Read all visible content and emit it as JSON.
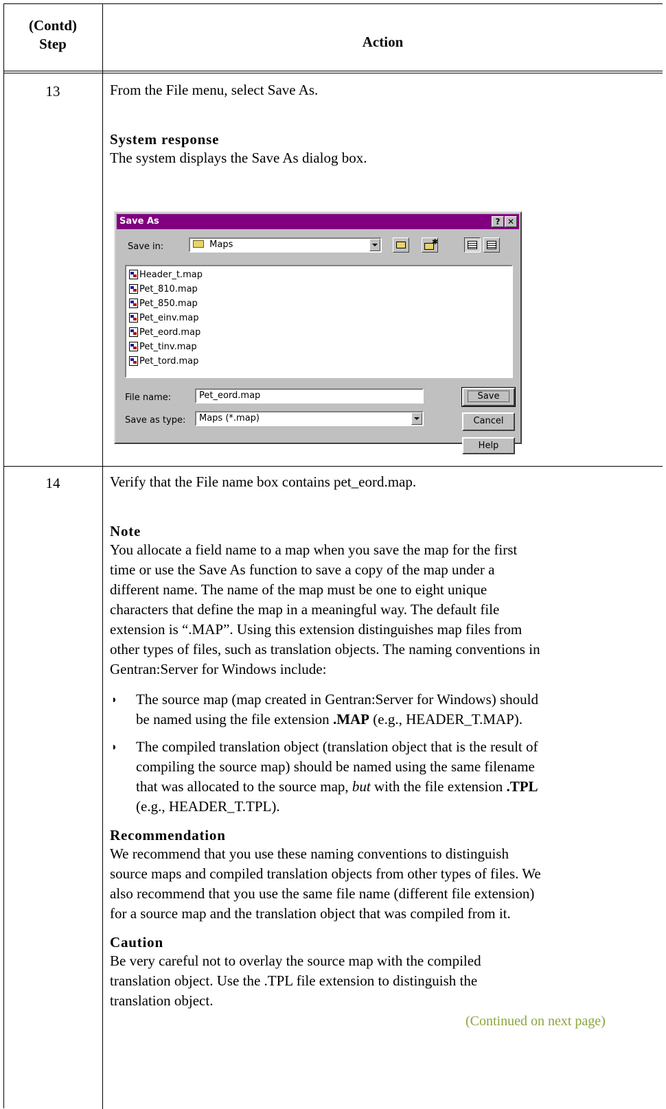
{
  "table": {
    "header_step": "(Contd)\nStep",
    "header_step_line1": "(Contd)",
    "header_step_line2": "Step",
    "header_action": "Action"
  },
  "step13": {
    "number": "13",
    "instruction": "From the File menu, select Save As.",
    "system_response_heading": "System response",
    "system_response_text": "The system displays the Save As dialog box."
  },
  "dialog": {
    "title": "Save As",
    "help_button": "?",
    "close_button": "✕",
    "save_in_label": "Save in:",
    "save_in_value": "Maps",
    "files": [
      "Header_t.map",
      "Pet_810.map",
      "Pet_850.map",
      "Pet_einv.map",
      "Pet_eord.map",
      "Pet_tinv.map",
      "Pet_tord.map"
    ],
    "file_name_label": "File name:",
    "file_name_value": "Pet_eord.map",
    "save_as_type_label": "Save as type:",
    "save_as_type_value": "Maps (*.map)",
    "save_button": "Save",
    "cancel_button": "Cancel",
    "help_label": "Help"
  },
  "step14": {
    "number": "14",
    "instruction": "Verify that the File name box contains pet_eord.map.",
    "note_heading": "Note",
    "note_lines": [
      "You allocate a field name to a map when you save the map for the first",
      "time or use the Save As function to save a copy of the map under a",
      "different name. The name of the map must be one to eight unique",
      "characters that define the map in a meaningful way. The default file",
      "extension is “.MAP”. Using this extension distinguishes map files from",
      "other types of files, such as translation objects. The naming conventions in",
      "Gentran:Server for Windows include:"
    ],
    "bullet_mark": "◗",
    "bullet1_line1": "The source map (map created in Gentran:Server for Windows) should",
    "bullet1_line2_pre": "be named using the file extension ",
    "bullet1_line2_bold": ".MAP",
    "bullet1_line2_post": " (e.g., HEADER_T.MAP).",
    "bullet2_line1": "The compiled translation object (translation object that is the result of",
    "bullet2_line2": "compiling the source map) should be named using the same filename",
    "bullet2_line3_pre": "that was allocated to the source map, ",
    "bullet2_line3_italic": "but",
    "bullet2_line3_mid": " with the file extension ",
    "bullet2_line3_bold": ".TPL",
    "bullet2_line4": "(e.g., HEADER_T.TPL).",
    "recommendation_heading": "Recommendation",
    "recommendation_lines": [
      "We recommend that you use these naming conventions to distinguish",
      "source maps and compiled translation objects from other types of files. We",
      "also recommend that you use the same file name (different file extension)",
      "for a source map and the translation object that was compiled from it."
    ],
    "caution_heading": "Caution",
    "caution_lines": [
      "Be very careful not to overlay the source map with the compiled",
      "translation object. Use the .TPL file extension to distinguish the",
      "translation object."
    ],
    "continued": "(Continued on next page)"
  }
}
